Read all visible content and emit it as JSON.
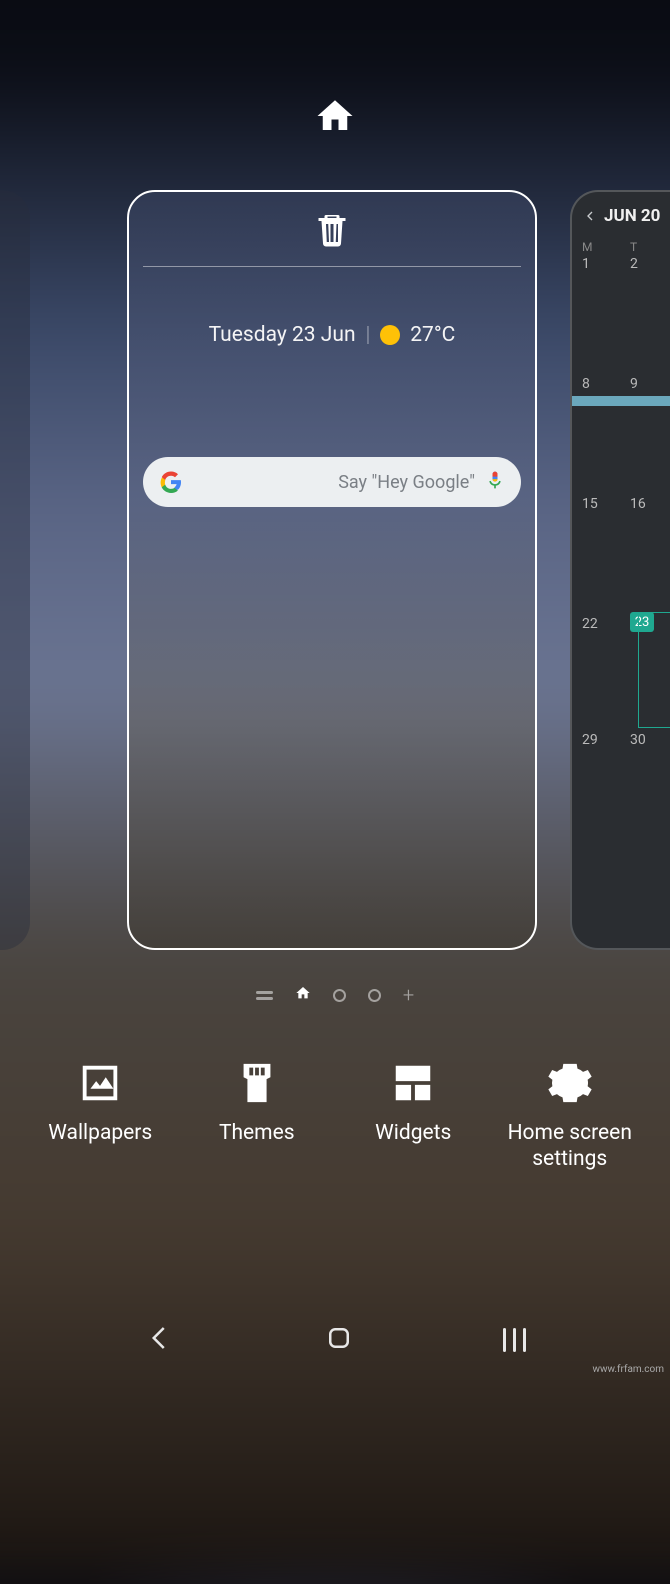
{
  "weather": {
    "date": "Tuesday 23 Jun",
    "temp": "27°C"
  },
  "search": {
    "placeholder": "Say \"Hey Google\""
  },
  "calendar": {
    "title": "JUN 20",
    "dow": [
      "M",
      "T"
    ],
    "weeks": [
      [
        "1",
        "2"
      ],
      [
        "8",
        "9"
      ],
      [
        "15",
        "16"
      ],
      [
        "22",
        "23"
      ],
      [
        "29",
        "30"
      ]
    ],
    "today": "23"
  },
  "options": {
    "wallpapers": "Wallpapers",
    "themes": "Themes",
    "widgets": "Widgets",
    "settings": "Home screen settings"
  },
  "watermark": "www.frfam.com"
}
